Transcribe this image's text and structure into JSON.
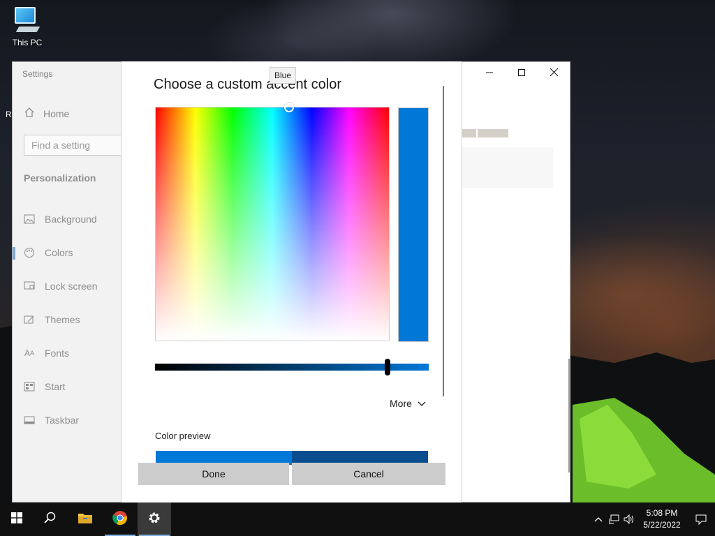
{
  "desktop": {
    "icon_label": "This PC",
    "edge_text": "R"
  },
  "settings_window": {
    "title": "Settings",
    "home_label": "Home",
    "search_placeholder": "Find a setting",
    "section_title": "Personalization",
    "nav_items": [
      {
        "label": "Background",
        "icon": "picture-icon"
      },
      {
        "label": "Colors",
        "icon": "palette-icon",
        "selected": true
      },
      {
        "label": "Lock screen",
        "icon": "lock-screen-icon"
      },
      {
        "label": "Themes",
        "icon": "themes-icon"
      },
      {
        "label": "Fonts",
        "icon": "fonts-icon"
      },
      {
        "label": "Start",
        "icon": "start-icon"
      },
      {
        "label": "Taskbar",
        "icon": "taskbar-icon"
      }
    ],
    "controls": {
      "minimize": "minimize-icon",
      "maximize": "maximize-icon",
      "close": "close-icon"
    }
  },
  "dialog": {
    "title": "Choose a custom accent color",
    "tooltip": "Blue",
    "selected_color": "#0078d7",
    "value_level": 0.85,
    "more_label": "More",
    "preview_label": "Color preview",
    "preview_colors": {
      "primary": "#0078d7",
      "secondary": "#0a4d8f"
    },
    "done_label": "Done",
    "cancel_label": "Cancel"
  },
  "taskbar": {
    "pinned": [
      "start-icon",
      "search-icon",
      "file-explorer-icon",
      "chrome-icon",
      "settings-icon"
    ],
    "active": "settings-icon",
    "time": "5:08 PM",
    "date": "5/22/2022"
  }
}
